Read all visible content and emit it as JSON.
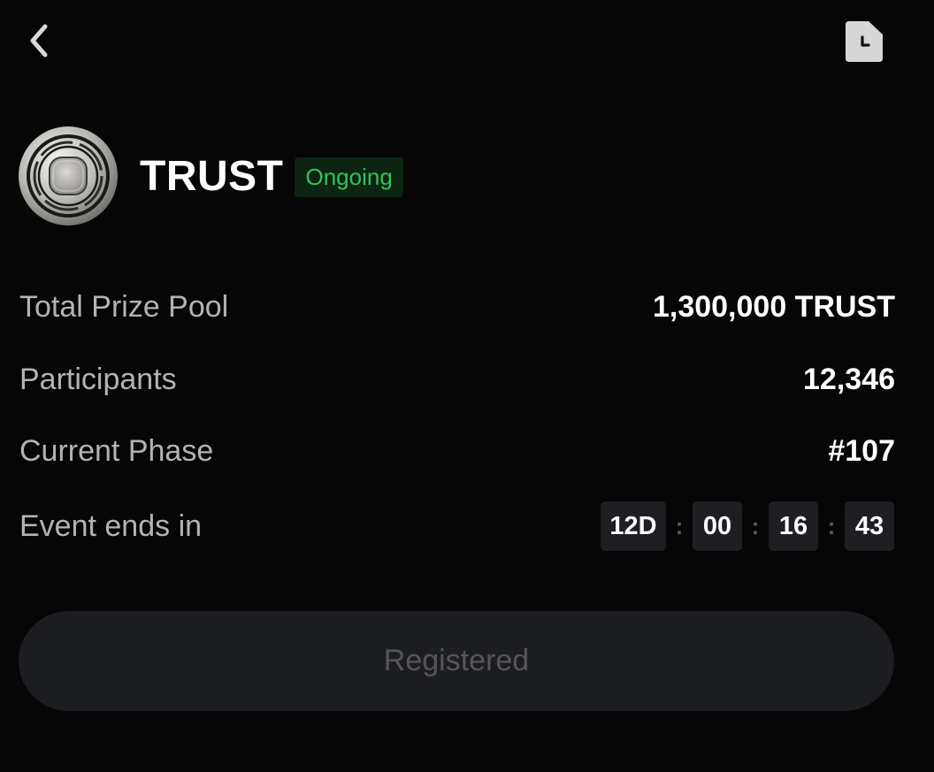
{
  "nav": {
    "back_icon": "chevron-left-icon",
    "history_icon": "document-clock-icon"
  },
  "token": {
    "name": "TRUST",
    "logo_icon": "trust-coin-logo",
    "status": "Ongoing",
    "status_color": "#32c25c"
  },
  "info": {
    "prize_pool_label": "Total Prize Pool",
    "prize_pool_value": "1,300,000 TRUST",
    "participants_label": "Participants",
    "participants_value": "12,346",
    "phase_label": "Current Phase",
    "phase_value": "#107",
    "ends_label": "Event ends in"
  },
  "countdown": {
    "days": "12D",
    "hours": "00",
    "minutes": "16",
    "seconds": "43",
    "separator": ":"
  },
  "action": {
    "button_label": "Registered"
  },
  "colors": {
    "background": "#060606",
    "accent_green": "#32c25c",
    "badge_bg": "#0c2412",
    "box_bg": "#1e1f23"
  }
}
